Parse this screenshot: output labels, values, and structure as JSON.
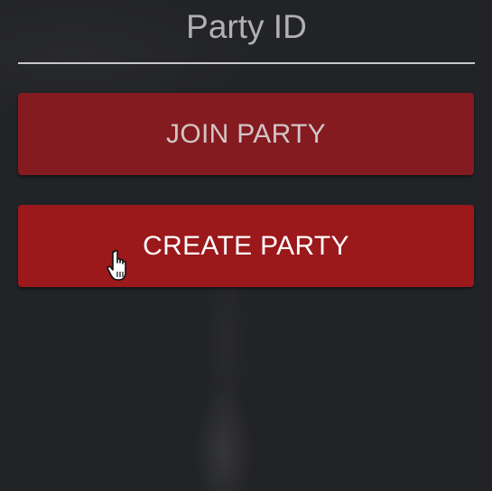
{
  "party_id_field": {
    "placeholder": "Party ID",
    "value": ""
  },
  "buttons": {
    "join_label": "JOIN PARTY",
    "create_label": "CREATE PARTY"
  },
  "colors": {
    "background": "#222327",
    "join_button": "#841b20",
    "create_button": "#9b181b",
    "underline": "#c8c8cc"
  },
  "icons": {
    "cursor": "hand-pointer-icon"
  }
}
